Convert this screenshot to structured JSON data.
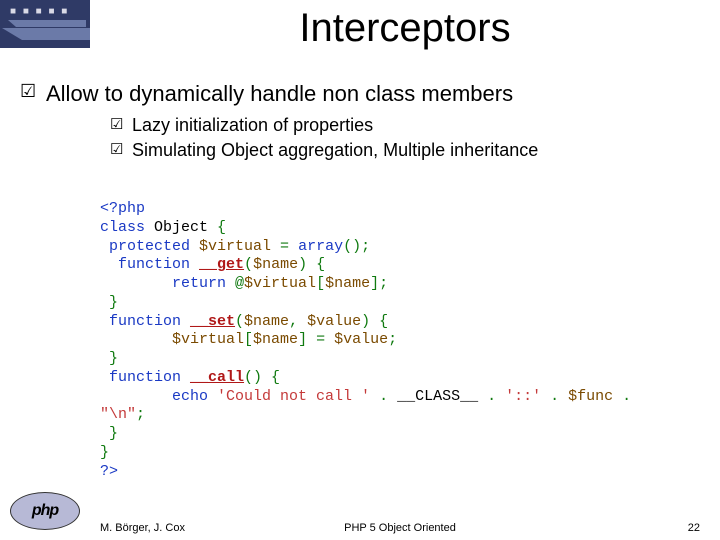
{
  "title": "Interceptors",
  "main_bullet": "Allow to dynamically handle non class members",
  "sub_bullets": [
    "Lazy initialization of properties",
    "Simulating Object aggregation, Multiple inheritance"
  ],
  "code": {
    "l1": "<?php",
    "l2a": "class",
    "l2b": " Object ",
    "l2c": "{",
    "l3a": " protected ",
    "l3b": "$virtual",
    "l3c": " = ",
    "l3d": "array",
    "l3e": "();",
    "l4a": "  function ",
    "l4b": "__get",
    "l4c": "(",
    "l4d": "$name",
    "l4e": ") {",
    "l5a": "        return ",
    "l5b": "@",
    "l5c": "$virtual",
    "l5d": "[",
    "l5e": "$name",
    "l5f": "];",
    "l6": " }",
    "l7a": " function ",
    "l7b": "__set",
    "l7c": "(",
    "l7d": "$name",
    "l7e": ", ",
    "l7f": "$value",
    "l7g": ") {",
    "l8a": "        ",
    "l8b": "$virtual",
    "l8c": "[",
    "l8d": "$name",
    "l8e": "] = ",
    "l8f": "$value",
    "l8g": ";",
    "l9": " }",
    "l10a": " function ",
    "l10b": "__call",
    "l10c": "() {",
    "l11a": "        echo ",
    "l11b": "'Could not call '",
    "l11c": " . ",
    "l11d": "__CLASS__",
    "l11e": " . ",
    "l11f": "'::'",
    "l11g": " . ",
    "l11h": "$func",
    "l11i": " .",
    "l12a": "\"\\n\"",
    "l12b": ";",
    "l13": " }",
    "l14": "}",
    "l15": "?>"
  },
  "footer": {
    "left": "M. Börger, J. Cox",
    "center": "PHP 5 Object Oriented",
    "right": "22"
  },
  "php_logo_text": "php"
}
